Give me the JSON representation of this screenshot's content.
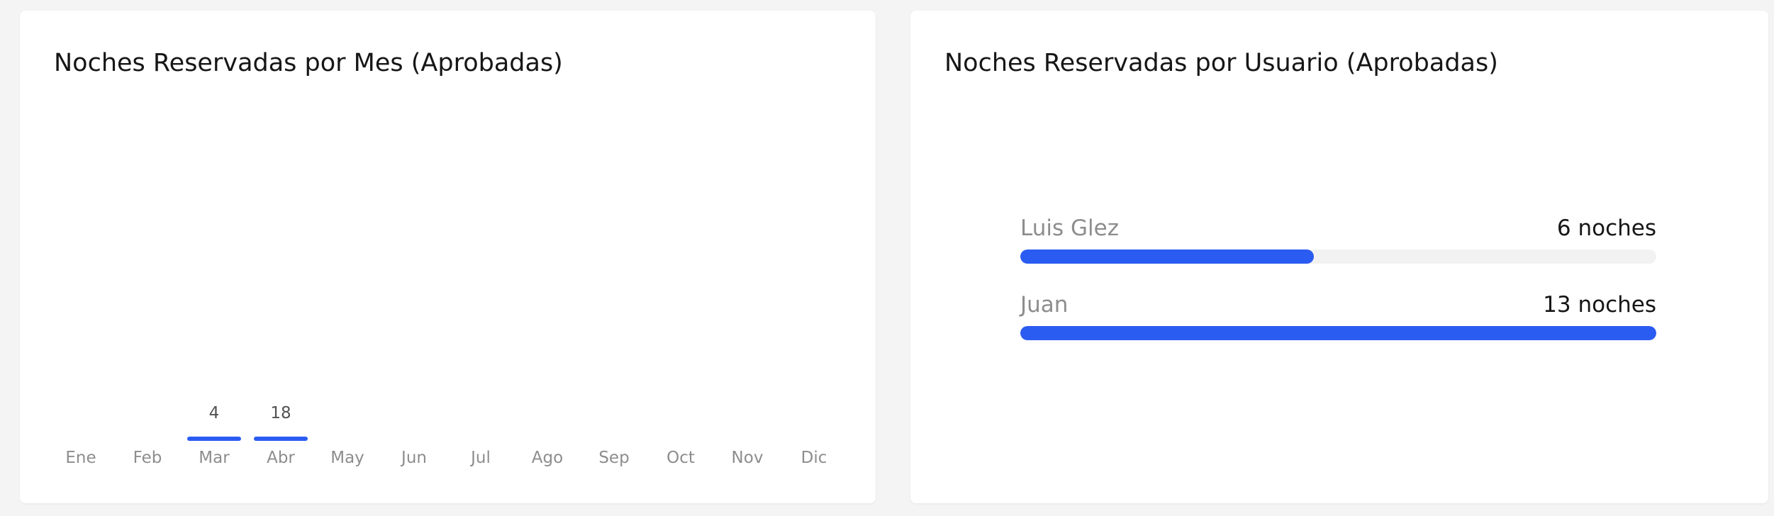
{
  "colors": {
    "accent": "#2b5cf2",
    "track": "#f2f2f2",
    "background": "#f4f4f4"
  },
  "chart_data": [
    {
      "type": "bar",
      "title": "Noches Reservadas por Mes (Aprobadas)",
      "categories": [
        "Ene",
        "Feb",
        "Mar",
        "Abr",
        "May",
        "Jun",
        "Jul",
        "Ago",
        "Sep",
        "Oct",
        "Nov",
        "Dic"
      ],
      "values": [
        0,
        0,
        4,
        18,
        0,
        0,
        0,
        0,
        0,
        0,
        0,
        0
      ],
      "data_labels": [
        "",
        "",
        "4",
        "18",
        "",
        "",
        "",
        "",
        "",
        "",
        "",
        ""
      ],
      "grid": false
    },
    {
      "type": "bar",
      "orientation": "horizontal",
      "title": "Noches Reservadas por Usuario (Aprobadas)",
      "categories": [
        "Luis Glez",
        "Juan"
      ],
      "values": [
        6,
        13
      ],
      "value_labels": [
        "6 noches",
        "13 noches"
      ],
      "grid": false
    }
  ]
}
